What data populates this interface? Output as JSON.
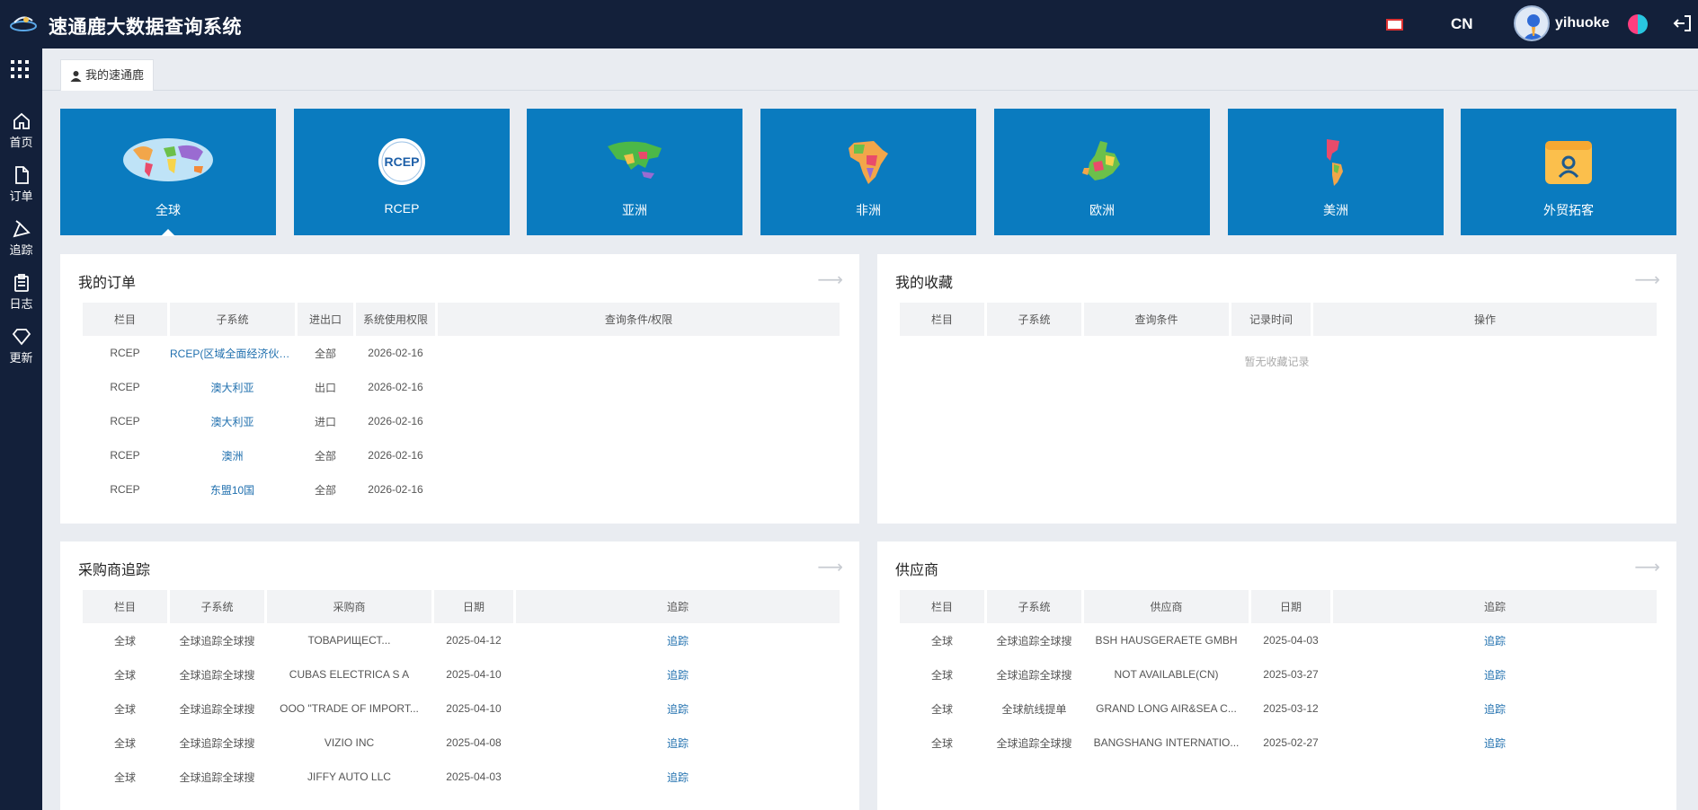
{
  "header": {
    "title": "速通鹿大数据查询系统",
    "lang": "CN",
    "username": "yihuoke",
    "icons": [
      "logo",
      "flag-icon",
      "avatar",
      "theme-icon",
      "logout-icon"
    ]
  },
  "sidebar": {
    "items": [
      {
        "label": "首页",
        "icon": "home-icon"
      },
      {
        "label": "订单",
        "icon": "document-icon"
      },
      {
        "label": "追踪",
        "icon": "track-icon"
      },
      {
        "label": "日志",
        "icon": "clipboard-icon"
      },
      {
        "label": "更新",
        "icon": "diamond-icon"
      }
    ]
  },
  "tab": {
    "label": "我的速通鹿"
  },
  "tiles": [
    {
      "label": "全球",
      "icon": "world-map-icon"
    },
    {
      "label": "RCEP",
      "icon": "rcep-logo-icon"
    },
    {
      "label": "亚洲",
      "icon": "asia-map-icon"
    },
    {
      "label": "非洲",
      "icon": "africa-map-icon"
    },
    {
      "label": "欧洲",
      "icon": "europe-map-icon"
    },
    {
      "label": "美洲",
      "icon": "americas-map-icon"
    },
    {
      "label": "外贸拓客",
      "icon": "user-box-icon"
    }
  ],
  "orders": {
    "title": "我的订单",
    "columns": [
      "栏目",
      "子系统",
      "进出口",
      "系统使用权限",
      "查询条件/权限"
    ],
    "rows": [
      [
        "RCEP",
        "RCEP(区域全面经济伙伴关",
        "全部",
        "2026-02-16",
        ""
      ],
      [
        "RCEP",
        "澳大利亚",
        "出口",
        "2026-02-16",
        ""
      ],
      [
        "RCEP",
        "澳大利亚",
        "进口",
        "2026-02-16",
        ""
      ],
      [
        "RCEP",
        "澳洲",
        "全部",
        "2026-02-16",
        ""
      ],
      [
        "RCEP",
        "东盟10国",
        "全部",
        "2026-02-16",
        ""
      ]
    ]
  },
  "favorites": {
    "title": "我的收藏",
    "columns": [
      "栏目",
      "子系统",
      "查询条件",
      "记录时间",
      "操作"
    ],
    "empty": "暂无收藏记录"
  },
  "buyers": {
    "title": "采购商追踪",
    "columns": [
      "栏目",
      "子系统",
      "采购商",
      "日期",
      "追踪"
    ],
    "rows": [
      [
        "全球",
        "全球追踪全球搜",
        "ТОВАРИЩЕСТ...",
        "2025-04-12",
        "追踪"
      ],
      [
        "全球",
        "全球追踪全球搜",
        "CUBAS ELECTRICA S A",
        "2025-04-10",
        "追踪"
      ],
      [
        "全球",
        "全球追踪全球搜",
        "OOO \"TRADE OF IMPORT...",
        "2025-04-10",
        "追踪"
      ],
      [
        "全球",
        "全球追踪全球搜",
        "VIZIO INC",
        "2025-04-08",
        "追踪"
      ],
      [
        "全球",
        "全球追踪全球搜",
        "JIFFY AUTO LLC",
        "2025-04-03",
        "追踪"
      ]
    ]
  },
  "suppliers": {
    "title": "供应商",
    "columns": [
      "栏目",
      "子系统",
      "供应商",
      "日期",
      "追踪"
    ],
    "rows": [
      [
        "全球",
        "全球追踪全球搜",
        "BSH HAUSGERAETE GMBH",
        "2025-04-03",
        "追踪"
      ],
      [
        "全球",
        "全球追踪全球搜",
        "NOT AVAILABLE(CN)",
        "2025-03-27",
        "追踪"
      ],
      [
        "全球",
        "全球航线提单",
        "GRAND LONG AIR&SEA C...",
        "2025-03-12",
        "追踪"
      ],
      [
        "全球",
        "全球追踪全球搜",
        "BANGSHANG INTERNATIO...",
        "2025-02-27",
        "追踪"
      ]
    ]
  },
  "colors": {
    "topbar": "#13203a",
    "tile": "#0a7bbf",
    "link": "#1f6fae",
    "background": "#e9ecf1"
  }
}
